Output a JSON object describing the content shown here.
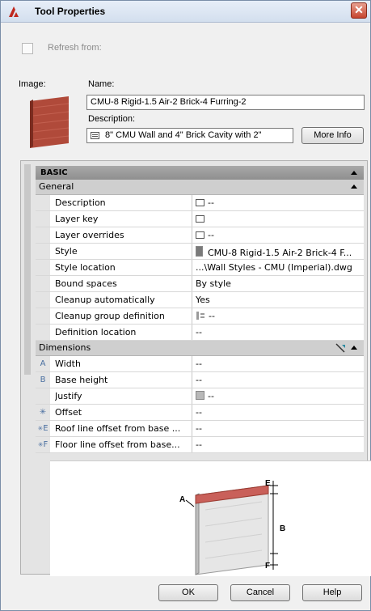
{
  "window": {
    "title": "Tool Properties"
  },
  "refresh": {
    "label": "Refresh from:"
  },
  "image_label": "Image:",
  "name": {
    "label": "Name:",
    "value": "CMU-8 Rigid-1.5 Air-2 Brick-4 Furring-2"
  },
  "description": {
    "label": "Description:",
    "value": "8\" CMU Wall and 4\" Brick Cavity with 2\"",
    "more_info": "More Info"
  },
  "panel": {
    "basic_label": "BASIC",
    "general": {
      "label": "General",
      "rows": [
        {
          "key": "Description",
          "value": "--"
        },
        {
          "key": "Layer key",
          "value": ""
        },
        {
          "key": "Layer overrides",
          "value": "--"
        },
        {
          "key": "Style",
          "value": "CMU-8 Rigid-1.5 Air-2 Brick-4 F..."
        },
        {
          "key": "Style location",
          "value": "...\\Wall Styles - CMU (Imperial).dwg"
        },
        {
          "key": "Bound spaces",
          "value": "By style"
        },
        {
          "key": "Cleanup automatically",
          "value": "Yes"
        },
        {
          "key": "Cleanup group definition",
          "value": "--"
        },
        {
          "key": "Definition location",
          "value": "--"
        }
      ]
    },
    "dimensions": {
      "label": "Dimensions",
      "rows": [
        {
          "gutter": "A",
          "key": "Width",
          "value": "--"
        },
        {
          "gutter": "B",
          "key": "Base height",
          "value": "--"
        },
        {
          "gutter": "",
          "key": "Justify",
          "value": "--"
        },
        {
          "gutter": "",
          "key": "Offset",
          "value": "--"
        },
        {
          "gutter": "E",
          "key": "Roof line offset from base ...",
          "value": "--"
        },
        {
          "gutter": "F",
          "key": "Floor line offset from base...",
          "value": "--"
        }
      ]
    },
    "diagram_labels": {
      "a": "A",
      "b": "B",
      "e": "E",
      "f": "F"
    }
  },
  "buttons": {
    "ok": "OK",
    "cancel": "Cancel",
    "help": "Help"
  },
  "colors": {
    "brick": "#b04a3a",
    "title_gradient_top": "#e7eef8",
    "close_red": "#c6442e"
  }
}
